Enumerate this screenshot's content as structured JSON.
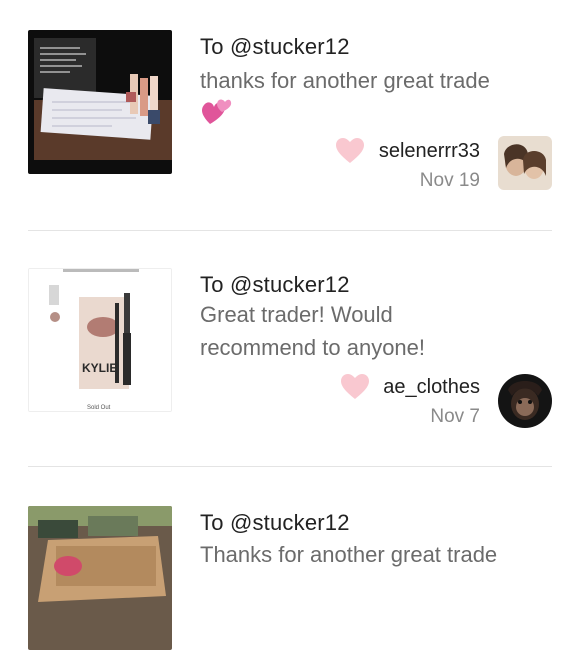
{
  "reviews": [
    {
      "to": "To @stucker12",
      "message_lines": [
        "thanks for another great trade"
      ],
      "has_emoji": true,
      "username": "selenerrr33",
      "date": "Nov 19",
      "heart_icon": "heart-icon",
      "heart_color": "#f9c8d0"
    },
    {
      "to": "To @stucker12",
      "message_lines": [
        "Great trader! Would",
        "recommend to anyone!"
      ],
      "has_emoji": false,
      "username": "ae_clothes",
      "date": "Nov 7",
      "heart_icon": "heart-icon",
      "heart_color": "#f9c8d0",
      "thumb_caption": "Sold Out",
      "thumb_brand": "KYLIE"
    },
    {
      "to": "To @stucker12",
      "message_lines": [
        "Thanks for another great trade"
      ],
      "has_emoji": false
    }
  ]
}
